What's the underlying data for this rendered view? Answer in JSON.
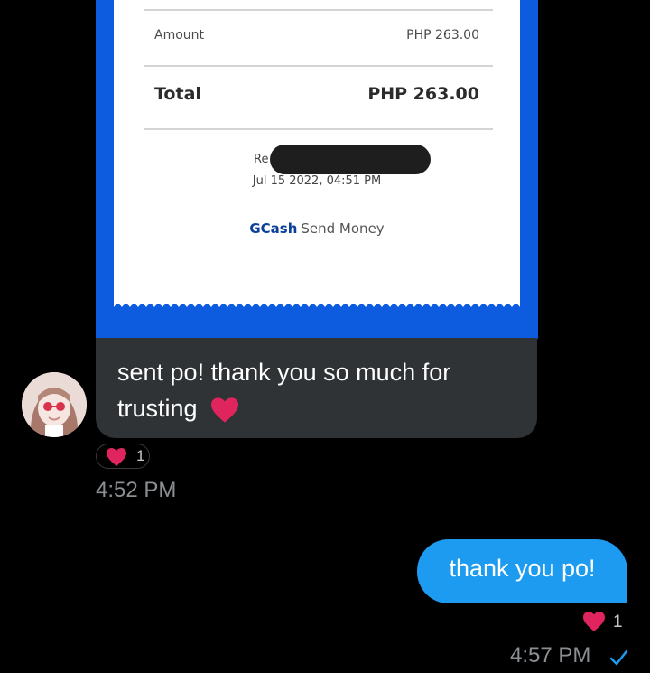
{
  "receipt": {
    "amount_label": "Amount",
    "amount_value": "PHP 263.00",
    "total_label": "Total",
    "total_value": "PHP 263.00",
    "ref_partial": "Re",
    "datetime": "Jul 15 2022, 04:51 PM",
    "brand_name": "GCash",
    "brand_action": "Send Money"
  },
  "received": {
    "text": "sent po! thank you so much for trusting",
    "reaction_icon": "heart-icon",
    "reaction_count": "1",
    "time": "4:52 PM"
  },
  "sent": {
    "text": "thank you po!",
    "reaction_icon": "heart-icon",
    "reaction_count": "1",
    "time": "4:57 PM",
    "status_icon": "check-icon"
  },
  "colors": {
    "background": "#000000",
    "incoming_bubble": "#2f3336",
    "outgoing_bubble": "#1d9bf0",
    "heart": "#e0245e",
    "receipt_blue": "#0d5ce0"
  }
}
